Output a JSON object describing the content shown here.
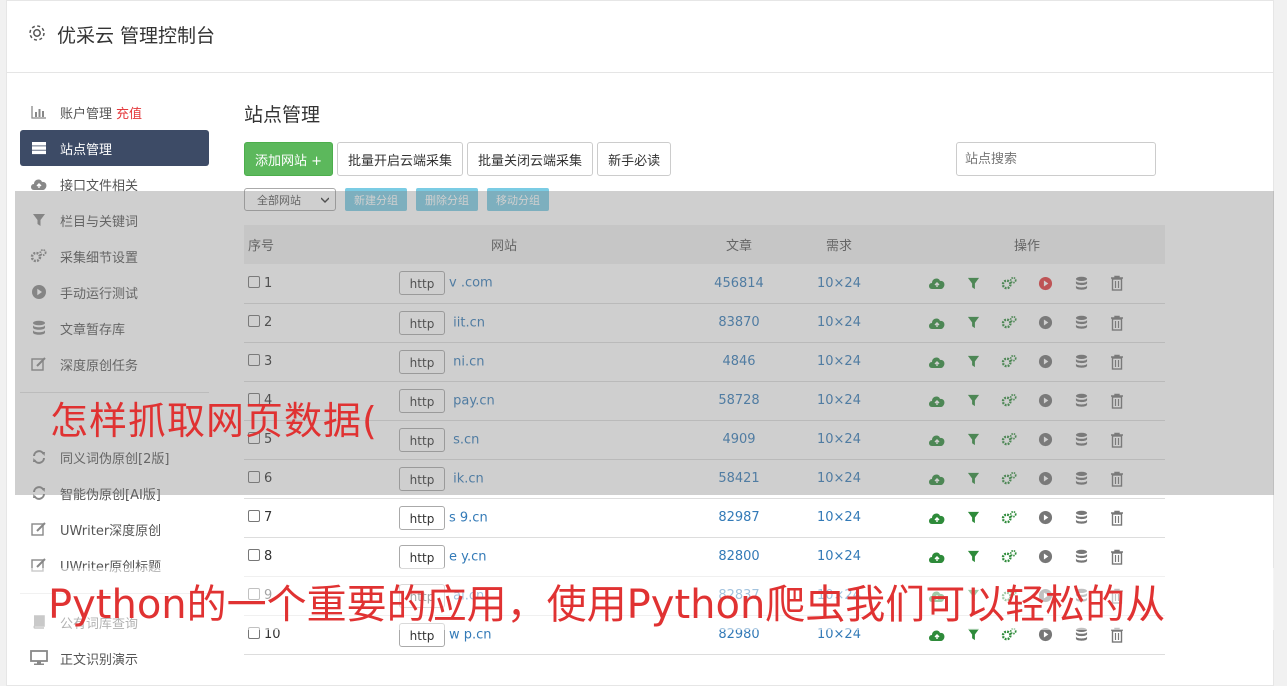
{
  "header": {
    "title": "优采云 管理控制台"
  },
  "sidebar": {
    "items": [
      {
        "label": "账户管理",
        "extra": "充值",
        "icon": "bar-chart-icon",
        "active": false
      },
      {
        "label": "站点管理",
        "icon": "server-icon",
        "active": true
      },
      {
        "label": "接口文件相关",
        "icon": "cloud-upload-icon",
        "active": false
      },
      {
        "label": "栏目与关键词",
        "icon": "filter-icon",
        "active": false
      },
      {
        "label": "采集细节设置",
        "icon": "gears-icon",
        "active": false
      },
      {
        "label": "手动运行测试",
        "icon": "play-circle-icon",
        "active": false
      },
      {
        "label": "文章暂存库",
        "icon": "database-icon",
        "active": false
      },
      {
        "label": "深度原创任务",
        "icon": "edit-icon",
        "active": false
      }
    ],
    "items2": [
      {
        "label": "同义词伪原创[2版]",
        "icon": "refresh-icon"
      },
      {
        "label": "智能伪原创[AI版]",
        "icon": "refresh-icon"
      },
      {
        "label": "UWriter深度原创",
        "icon": "edit-icon"
      },
      {
        "label": "UWriter原创标题",
        "icon": "edit-icon"
      }
    ],
    "items3": [
      {
        "label": "公有词库查询",
        "icon": "book-icon"
      },
      {
        "label": "正文识别演示",
        "icon": "monitor-icon"
      }
    ]
  },
  "main": {
    "title": "站点管理",
    "buttons": {
      "add": "添加网站 +",
      "batch_on": "批量开启云端采集",
      "batch_off": "批量关闭云端采集",
      "guide": "新手必读"
    },
    "search_placeholder": "站点搜索",
    "group_select": "全部网站",
    "group_buttons": {
      "new": "新建分组",
      "delete": "删除分组",
      "move": "移动分组"
    },
    "table": {
      "headers": {
        "no": "序号",
        "site": "网站",
        "articles": "文章",
        "demand": "需求",
        "ops": "操作"
      },
      "rows": [
        {
          "no": "1",
          "http": "http",
          "site": "v         .com",
          "articles": "456814",
          "demand": "10×24",
          "running": true
        },
        {
          "no": "2",
          "http": "http",
          "site": "      iit.cn",
          "articles": "83870",
          "demand": "10×24",
          "running": false
        },
        {
          "no": "3",
          "http": "http",
          "site": "      ni.cn",
          "articles": "4846",
          "demand": "10×24",
          "running": false
        },
        {
          "no": "4",
          "http": "http",
          "site": "      pay.cn",
          "articles": "58728",
          "demand": "10×24",
          "running": false
        },
        {
          "no": "5",
          "http": "http",
          "site": "      s.cn",
          "articles": "4909",
          "demand": "10×24",
          "running": false
        },
        {
          "no": "6",
          "http": "http",
          "site": "      ik.cn",
          "articles": "58421",
          "demand": "10×24",
          "running": false
        },
        {
          "no": "7",
          "http": "http",
          "site": "s    9.cn",
          "articles": "82987",
          "demand": "10×24",
          "running": false
        },
        {
          "no": "8",
          "http": "http",
          "site": "e     y.cn",
          "articles": "82800",
          "demand": "10×24",
          "running": false
        },
        {
          "no": "9",
          "http": "http",
          "site": "      ai.cn",
          "articles": "82837",
          "demand": "10×24",
          "running": false
        },
        {
          "no": "10",
          "http": "http",
          "site": "w     p.cn",
          "articles": "82980",
          "demand": "10×24",
          "running": false
        }
      ]
    }
  },
  "overlay": {
    "line1": "怎样抓取网页数据(",
    "line2": "Python的一个重要的应用，使用Python爬虫我们可以轻松的从"
  },
  "colors": {
    "active_nav": "#3d4b66",
    "green": "#5cb85c",
    "link": "#337ab7",
    "overlay_text": "#e03232",
    "run": "#e4393c"
  }
}
